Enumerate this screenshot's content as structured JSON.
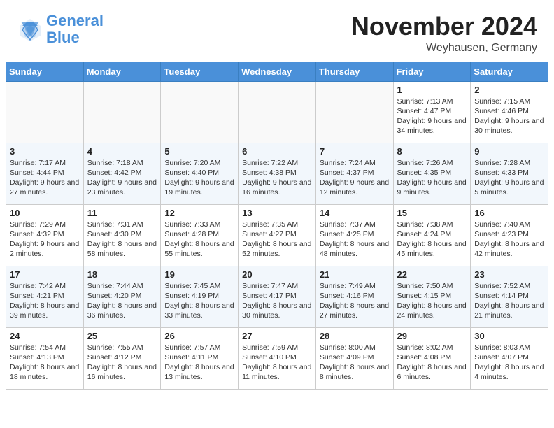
{
  "header": {
    "logo_line1": "General",
    "logo_line2": "Blue",
    "month": "November 2024",
    "location": "Weyhausen, Germany"
  },
  "weekdays": [
    "Sunday",
    "Monday",
    "Tuesday",
    "Wednesday",
    "Thursday",
    "Friday",
    "Saturday"
  ],
  "weeks": [
    [
      {
        "day": "",
        "info": ""
      },
      {
        "day": "",
        "info": ""
      },
      {
        "day": "",
        "info": ""
      },
      {
        "day": "",
        "info": ""
      },
      {
        "day": "",
        "info": ""
      },
      {
        "day": "1",
        "info": "Sunrise: 7:13 AM\nSunset: 4:47 PM\nDaylight: 9 hours and 34 minutes."
      },
      {
        "day": "2",
        "info": "Sunrise: 7:15 AM\nSunset: 4:46 PM\nDaylight: 9 hours and 30 minutes."
      }
    ],
    [
      {
        "day": "3",
        "info": "Sunrise: 7:17 AM\nSunset: 4:44 PM\nDaylight: 9 hours and 27 minutes."
      },
      {
        "day": "4",
        "info": "Sunrise: 7:18 AM\nSunset: 4:42 PM\nDaylight: 9 hours and 23 minutes."
      },
      {
        "day": "5",
        "info": "Sunrise: 7:20 AM\nSunset: 4:40 PM\nDaylight: 9 hours and 19 minutes."
      },
      {
        "day": "6",
        "info": "Sunrise: 7:22 AM\nSunset: 4:38 PM\nDaylight: 9 hours and 16 minutes."
      },
      {
        "day": "7",
        "info": "Sunrise: 7:24 AM\nSunset: 4:37 PM\nDaylight: 9 hours and 12 minutes."
      },
      {
        "day": "8",
        "info": "Sunrise: 7:26 AM\nSunset: 4:35 PM\nDaylight: 9 hours and 9 minutes."
      },
      {
        "day": "9",
        "info": "Sunrise: 7:28 AM\nSunset: 4:33 PM\nDaylight: 9 hours and 5 minutes."
      }
    ],
    [
      {
        "day": "10",
        "info": "Sunrise: 7:29 AM\nSunset: 4:32 PM\nDaylight: 9 hours and 2 minutes."
      },
      {
        "day": "11",
        "info": "Sunrise: 7:31 AM\nSunset: 4:30 PM\nDaylight: 8 hours and 58 minutes."
      },
      {
        "day": "12",
        "info": "Sunrise: 7:33 AM\nSunset: 4:28 PM\nDaylight: 8 hours and 55 minutes."
      },
      {
        "day": "13",
        "info": "Sunrise: 7:35 AM\nSunset: 4:27 PM\nDaylight: 8 hours and 52 minutes."
      },
      {
        "day": "14",
        "info": "Sunrise: 7:37 AM\nSunset: 4:25 PM\nDaylight: 8 hours and 48 minutes."
      },
      {
        "day": "15",
        "info": "Sunrise: 7:38 AM\nSunset: 4:24 PM\nDaylight: 8 hours and 45 minutes."
      },
      {
        "day": "16",
        "info": "Sunrise: 7:40 AM\nSunset: 4:23 PM\nDaylight: 8 hours and 42 minutes."
      }
    ],
    [
      {
        "day": "17",
        "info": "Sunrise: 7:42 AM\nSunset: 4:21 PM\nDaylight: 8 hours and 39 minutes."
      },
      {
        "day": "18",
        "info": "Sunrise: 7:44 AM\nSunset: 4:20 PM\nDaylight: 8 hours and 36 minutes."
      },
      {
        "day": "19",
        "info": "Sunrise: 7:45 AM\nSunset: 4:19 PM\nDaylight: 8 hours and 33 minutes."
      },
      {
        "day": "20",
        "info": "Sunrise: 7:47 AM\nSunset: 4:17 PM\nDaylight: 8 hours and 30 minutes."
      },
      {
        "day": "21",
        "info": "Sunrise: 7:49 AM\nSunset: 4:16 PM\nDaylight: 8 hours and 27 minutes."
      },
      {
        "day": "22",
        "info": "Sunrise: 7:50 AM\nSunset: 4:15 PM\nDaylight: 8 hours and 24 minutes."
      },
      {
        "day": "23",
        "info": "Sunrise: 7:52 AM\nSunset: 4:14 PM\nDaylight: 8 hours and 21 minutes."
      }
    ],
    [
      {
        "day": "24",
        "info": "Sunrise: 7:54 AM\nSunset: 4:13 PM\nDaylight: 8 hours and 18 minutes."
      },
      {
        "day": "25",
        "info": "Sunrise: 7:55 AM\nSunset: 4:12 PM\nDaylight: 8 hours and 16 minutes."
      },
      {
        "day": "26",
        "info": "Sunrise: 7:57 AM\nSunset: 4:11 PM\nDaylight: 8 hours and 13 minutes."
      },
      {
        "day": "27",
        "info": "Sunrise: 7:59 AM\nSunset: 4:10 PM\nDaylight: 8 hours and 11 minutes."
      },
      {
        "day": "28",
        "info": "Sunrise: 8:00 AM\nSunset: 4:09 PM\nDaylight: 8 hours and 8 minutes."
      },
      {
        "day": "29",
        "info": "Sunrise: 8:02 AM\nSunset: 4:08 PM\nDaylight: 8 hours and 6 minutes."
      },
      {
        "day": "30",
        "info": "Sunrise: 8:03 AM\nSunset: 4:07 PM\nDaylight: 8 hours and 4 minutes."
      }
    ]
  ]
}
